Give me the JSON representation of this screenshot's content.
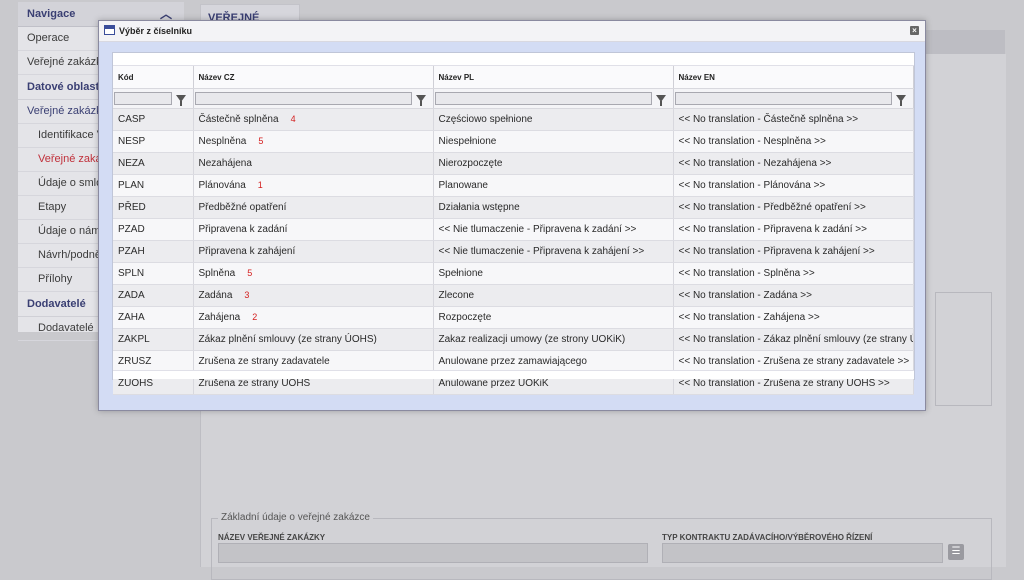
{
  "nav": {
    "header": "Navigace",
    "items": [
      {
        "label": "Operace",
        "type": "item"
      },
      {
        "label": "Veřejné zakázky",
        "type": "item"
      },
      {
        "label": "Datové oblasti",
        "type": "section"
      },
      {
        "label": "Veřejné zakázky",
        "type": "section-light"
      },
      {
        "label": "Identifikace V",
        "type": "sub"
      },
      {
        "label": "Veřejné zakáz",
        "type": "sub-active"
      },
      {
        "label": "Údaje o smlou",
        "type": "sub"
      },
      {
        "label": "Etapy",
        "type": "sub"
      },
      {
        "label": "Údaje o námit",
        "type": "sub"
      },
      {
        "label": "Návrh/podnět",
        "type": "sub"
      },
      {
        "label": "Přílohy",
        "type": "sub"
      },
      {
        "label": "Dodavatelé",
        "type": "section"
      },
      {
        "label": "Dodavatelé",
        "type": "sub"
      }
    ]
  },
  "page": {
    "tab_title": "VEŘEJNÉ ZAKÁZKY",
    "fieldset_legend": "Základní údaje o veřejné zakázce",
    "field1_label": "NÁZEV VEŘEJNÉ ZAKÁZKY",
    "field2_label": "TYP KONTRAKTU ZADÁVACÍHO/VÝBĚROVÉHO ŘÍZENÍ"
  },
  "modal": {
    "title": "Výběr z číselníku",
    "columns": [
      "Kód",
      "Název CZ",
      "Název PL",
      "Název EN"
    ],
    "rows": [
      {
        "code": "CASP",
        "cz": "Částečně splněna",
        "ann": "4",
        "pl": "Częściowo spełnione",
        "en": "<< No translation - Částečně splněna >>"
      },
      {
        "code": "NESP",
        "cz": "Nesplněna",
        "ann": "5",
        "pl": "Niespełnione",
        "en": "<< No translation - Nesplněna >>"
      },
      {
        "code": "NEZA",
        "cz": "Nezahájena",
        "ann": "",
        "pl": "Nierozpoczęte",
        "en": "<< No translation - Nezahájena >>"
      },
      {
        "code": "PLAN",
        "cz": "Plánována",
        "ann": "1",
        "pl": "Planowane",
        "en": "<< No translation - Plánována >>"
      },
      {
        "code": "PŘED",
        "cz": "Předběžné opatření",
        "ann": "",
        "pl": "Działania wstępne",
        "en": "<< No translation - Předběžné opatření >>"
      },
      {
        "code": "PZAD",
        "cz": "Připravena k zadání",
        "ann": "",
        "pl": "<< Nie tlumaczenie - Připravena k zadání >>",
        "en": "<< No translation - Připravena k zadání >>"
      },
      {
        "code": "PZAH",
        "cz": "Připravena k zahájení",
        "ann": "",
        "pl": "<< Nie tlumaczenie - Připravena k zahájení >>",
        "en": "<< No translation - Připravena k zahájení >>"
      },
      {
        "code": "SPLN",
        "cz": "Splněna",
        "ann": "5",
        "pl": "Spełnione",
        "en": "<< No translation - Splněna >>"
      },
      {
        "code": "ZADA",
        "cz": "Zadána",
        "ann": "3",
        "pl": "Zlecone",
        "en": "<< No translation - Zadána >>"
      },
      {
        "code": "ZAHA",
        "cz": "Zahájena",
        "ann": "2",
        "pl": "Rozpoczęte",
        "en": "<< No translation - Zahájena >>"
      },
      {
        "code": "ZAKPL",
        "cz": "Zákaz plnění smlouvy (ze strany ÚOHS)",
        "ann": "",
        "pl": "Zakaz realizacji umowy (ze strony UOKiK)",
        "en": "<< No translation - Zákaz plnění smlouvy (ze strany ÚOHS) >>"
      },
      {
        "code": "ZRUSZ",
        "cz": "Zrušena ze strany zadavatele",
        "ann": "",
        "pl": "Anulowane przez zamawiającego",
        "en": "<< No translation - Zrušena ze strany zadavatele >>"
      },
      {
        "code": "ZUOHS",
        "cz": "Zrušena ze strany ÚOHS",
        "ann": "",
        "pl": "Anulowane przez UOKiK",
        "en": "<< No translation - Zrušena ze strany ÚOHS >>"
      }
    ]
  },
  "icons": {
    "close": "close-icon",
    "filter": "filter-icon",
    "dialog": "dialog-icon",
    "collapse": "chevron-up-icon",
    "list": "list-icon"
  },
  "colors": {
    "accent": "#3a3f73",
    "active": "#c0303a",
    "annotation": "#d42020",
    "modal_bg": "#d3dcf4"
  }
}
